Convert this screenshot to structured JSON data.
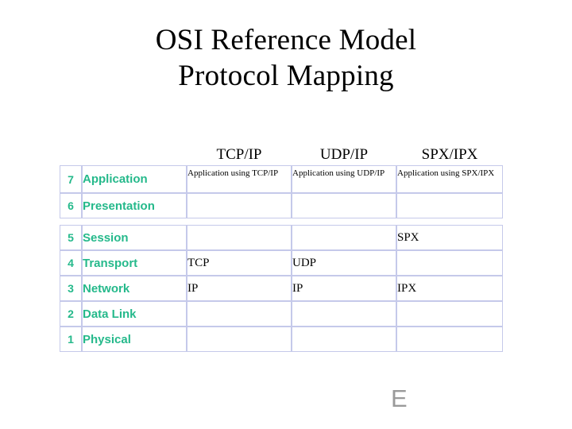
{
  "slide": {
    "title_line1": "OSI Reference Model",
    "title_line2": "Protocol Mapping",
    "watermark": "E",
    "accent_color": "#25b98b",
    "border_color": "#c5c9ea",
    "text_color": "#000000",
    "background_color": "#ffffff"
  },
  "table": {
    "column_headers": {
      "number": "",
      "layer": "",
      "tcpip": "TCP/IP",
      "udpip": "UDP/IP",
      "spxipx": "SPX/IPX"
    },
    "rows": [
      {
        "number": "7",
        "layer": "Application",
        "tcpip": "Application using TCP/IP",
        "udpip": "Application using UDP/IP",
        "spxipx": "Application using SPX/IPX"
      },
      {
        "number": "6",
        "layer": "Presentation",
        "tcpip": "",
        "udpip": "",
        "spxipx": ""
      },
      {
        "number": "5",
        "layer": "Session",
        "tcpip": "",
        "udpip": "",
        "spxipx": "SPX"
      },
      {
        "number": "4",
        "layer": "Transport",
        "tcpip": "TCP",
        "udpip": "UDP",
        "spxipx": ""
      },
      {
        "number": "3",
        "layer": "Network",
        "tcpip": "IP",
        "udpip": "IP",
        "spxipx": "IPX"
      },
      {
        "number": "2",
        "layer": "Data Link",
        "tcpip": "",
        "udpip": "",
        "spxipx": ""
      },
      {
        "number": "1",
        "layer": "Physical",
        "tcpip": "",
        "udpip": "",
        "spxipx": ""
      }
    ]
  }
}
